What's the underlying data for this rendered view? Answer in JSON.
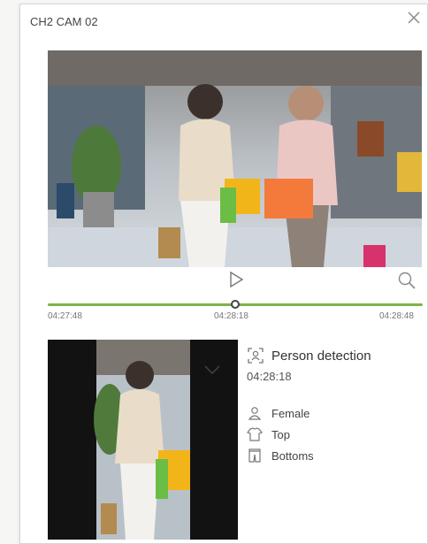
{
  "window": {
    "title": "CH2 CAM 02"
  },
  "icons": {
    "close": "close-icon",
    "play": "play-icon",
    "zoom": "search-icon",
    "person": "person-detection-icon",
    "female": "female-icon",
    "top": "top-clothing-icon",
    "bottoms": "bottoms-clothing-icon"
  },
  "timeline": {
    "start": "04:27:48",
    "current": "04:28:18",
    "end": "04:28:48",
    "progress": 0.5,
    "accent": "#7ab648"
  },
  "detection": {
    "type": "Person detection",
    "time": "04:28:18",
    "attributes": [
      "Female",
      "Top",
      "Bottoms"
    ]
  }
}
